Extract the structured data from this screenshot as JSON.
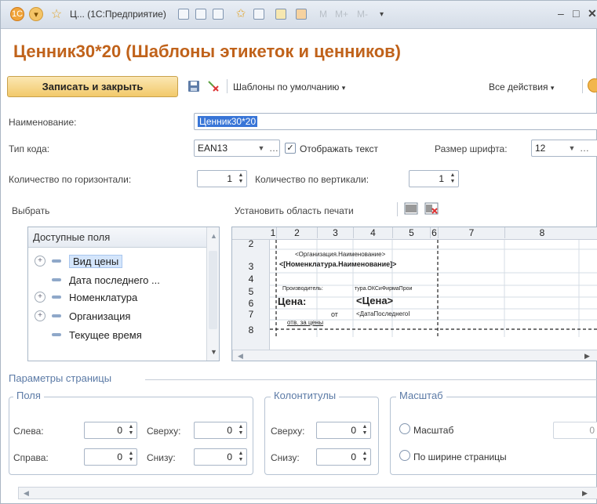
{
  "window": {
    "title": "Ц... (1С:Предприятие)",
    "memory_buttons": [
      "M",
      "M+",
      "M-"
    ]
  },
  "form": {
    "title": "Ценник30*20 (Шаблоны этикеток и ценников)"
  },
  "toolbar": {
    "save_close_label": "Записать и закрыть",
    "defaults_label": "Шаблоны по умолчанию",
    "all_actions_label": "Все действия"
  },
  "fields": {
    "name_label": "Наименование:",
    "name_value": "Ценник30*20",
    "code_type_label": "Тип кода:",
    "code_type_value": "EAN13",
    "show_text_label": "Отображать текст",
    "show_text_checked": true,
    "font_size_label": "Размер шрифта:",
    "font_size_value": "12",
    "horiz_label": "Количество по горизонтали:",
    "horiz_value": "1",
    "vert_label": "Количество по вертикали:",
    "vert_value": "1"
  },
  "select_label": "Выбрать",
  "print_area_label": "Установить область печати",
  "available_fields": {
    "header": "Доступные поля",
    "items": [
      {
        "label": "Вид цены",
        "expandable": true,
        "selected": true
      },
      {
        "label": "Дата последнего ...",
        "expandable": false,
        "selected": false
      },
      {
        "label": "Номенклатура",
        "expandable": true,
        "selected": false
      },
      {
        "label": "Организация",
        "expandable": true,
        "selected": false
      },
      {
        "label": "Текущее время",
        "expandable": false,
        "selected": false
      }
    ]
  },
  "template_grid": {
    "columns": [
      "1",
      "2",
      "3",
      "4",
      "5",
      "6",
      "7",
      "8"
    ],
    "rows": [
      "2",
      "3",
      "4",
      "5",
      "6",
      "7",
      "8"
    ],
    "cells": {
      "org": "<Организация.Наименование>",
      "nom": "<[Номенклатура.Наименование]>",
      "manufacturer_label": "Производитель:",
      "manufacturer_value": "тура.ОКСиФирмаПрои",
      "price_label": "Цена:",
      "price_value": "<Цена>",
      "from": "от",
      "date_value": "<ДатаПоследнегоI",
      "responsible": "отв. за цены"
    }
  },
  "page_params": {
    "title": "Параметры страницы",
    "margins": {
      "title": "Поля",
      "left_label": "Слева:",
      "left_value": "0",
      "top_label": "Сверху:",
      "top_value": "0",
      "right_label": "Справа:",
      "right_value": "0",
      "bottom_label": "Снизу:",
      "bottom_value": "0"
    },
    "headers": {
      "title": "Колонтитулы",
      "top_label": "Сверху:",
      "top_value": "0",
      "bottom_label": "Снизу:",
      "bottom_value": "0"
    },
    "scale": {
      "title": "Масштаб",
      "scale_label": "Масштаб",
      "scale_value": "0",
      "fit_width_label": "По ширине страницы"
    }
  }
}
